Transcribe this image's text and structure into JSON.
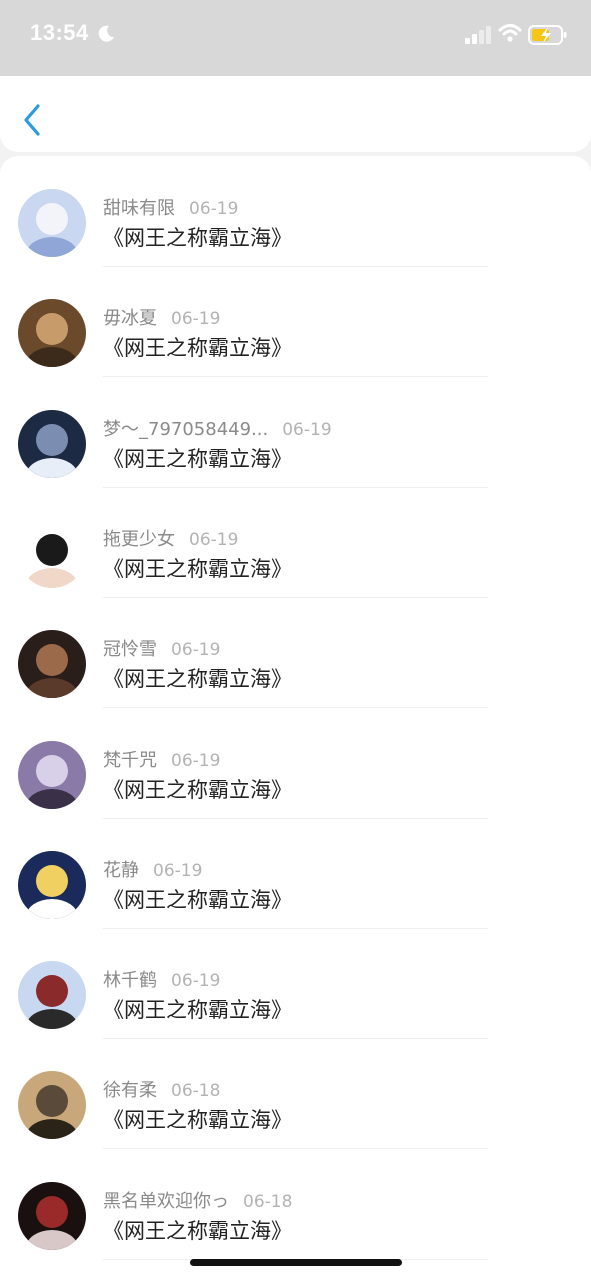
{
  "status_bar": {
    "time": "13:54",
    "icons": [
      "moon-icon",
      "signal-icon",
      "wifi-icon",
      "battery-charging-icon"
    ],
    "accent_battery": "#f5c518"
  },
  "nav": {
    "back_icon": "chevron-left-icon",
    "accent": "#2a9be0"
  },
  "items": [
    {
      "name": "甜味有限",
      "date": "06-19",
      "message": "《网王之称霸立海》",
      "avatar_colors": [
        "#c9d8f0",
        "#f3f3fa",
        "#8fa6d6"
      ]
    },
    {
      "name": "毋冰夏",
      "date": "06-19",
      "message": "《网王之称霸立海》",
      "avatar_colors": [
        "#6a4a2a",
        "#c89c6a",
        "#3c2a1a"
      ]
    },
    {
      "name": "梦～_797058449...",
      "date": "06-19",
      "message": "《网王之称霸立海》",
      "avatar_colors": [
        "#1c2a44",
        "#7b8db0",
        "#e8eef8"
      ]
    },
    {
      "name": "拖更少女",
      "date": "06-19",
      "message": "《网王之称霸立海》",
      "avatar_colors": [
        "#ffffff",
        "#1a1a1a",
        "#f1d7c8"
      ]
    },
    {
      "name": "冠怜雪",
      "date": "06-19",
      "message": "《网王之称霸立海》",
      "avatar_colors": [
        "#2a1e1a",
        "#9a6a4a",
        "#5a3a2a"
      ]
    },
    {
      "name": "梵千咒",
      "date": "06-19",
      "message": "《网王之称霸立海》",
      "avatar_colors": [
        "#8a7aa8",
        "#d8d0e8",
        "#3a3048"
      ]
    },
    {
      "name": "花静",
      "date": "06-19",
      "message": "《网王之称霸立海》",
      "avatar_colors": [
        "#1a2a5a",
        "#f0d060",
        "#ffffff"
      ]
    },
    {
      "name": "林千鹤",
      "date": "06-19",
      "message": "《网王之称霸立海》",
      "avatar_colors": [
        "#c8d8f0",
        "#8a2a2a",
        "#2a2a2a"
      ]
    },
    {
      "name": "徐有柔",
      "date": "06-18",
      "message": "《网王之称霸立海》",
      "avatar_colors": [
        "#c8a87a",
        "#5a4a3a",
        "#2a2418"
      ]
    },
    {
      "name": "黑名单欢迎你っ",
      "date": "06-18",
      "message": "《网王之称霸立海》",
      "avatar_colors": [
        "#1a1010",
        "#9a2a2a",
        "#d8c8c8"
      ]
    }
  ]
}
